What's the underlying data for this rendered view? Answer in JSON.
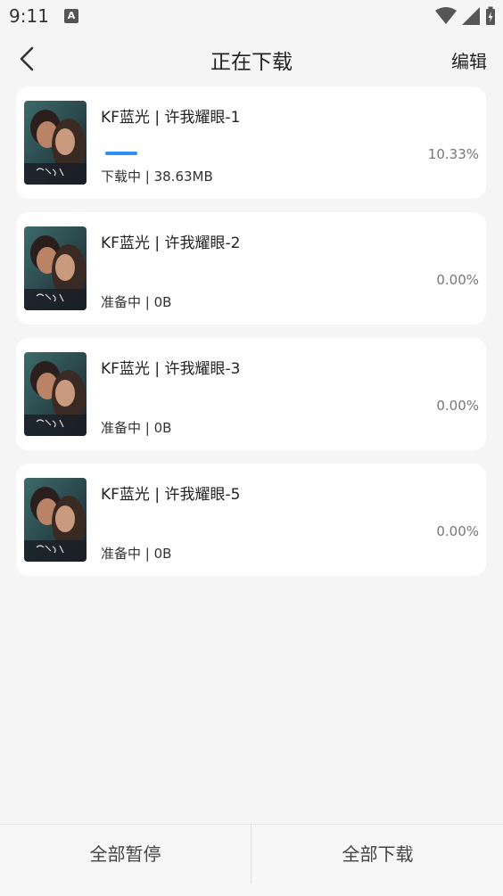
{
  "status_bar": {
    "time": "9:11",
    "notification_letter": "A"
  },
  "header": {
    "title": "正在下载",
    "edit_label": "编辑"
  },
  "downloads": [
    {
      "title": "KF蓝光 | 许我耀眼-1",
      "status": "下载中 | 38.63MB",
      "percent": "10.33%",
      "progress": 0.1033
    },
    {
      "title": "KF蓝光 | 许我耀眼-2",
      "status": "准备中 | 0B",
      "percent": "0.00%",
      "progress": 0
    },
    {
      "title": "KF蓝光 | 许我耀眼-3",
      "status": "准备中 | 0B",
      "percent": "0.00%",
      "progress": 0
    },
    {
      "title": "KF蓝光 | 许我耀眼-5",
      "status": "准备中 | 0B",
      "percent": "0.00%",
      "progress": 0
    }
  ],
  "footer": {
    "pause_all": "全部暂停",
    "download_all": "全部下载"
  },
  "colors": {
    "accent": "#2f8df3",
    "background": "#f5f5f5",
    "card": "#ffffff"
  }
}
